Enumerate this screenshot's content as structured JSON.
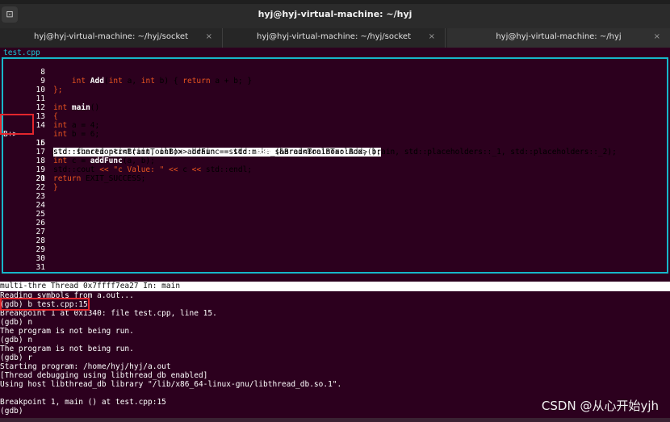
{
  "window": {
    "title": "hyj@hyj-virtual-machine: ~/hyj",
    "new_tab_icon": "terminal-plus-icon"
  },
  "tabs": [
    {
      "label": "hyj@hyj-virtual-machine: ~/hyj/socket",
      "close": "×"
    },
    {
      "label": "hyj@hyj-virtual-machine: ~/hyj/socket",
      "close": "×"
    },
    {
      "label": "hyj@hyj-virtual-machine: ~/hyj",
      "close": "×"
    }
  ],
  "source": {
    "filename": "test.cpp",
    "breakpoint_marker": "B+>",
    "lines": [
      {
        "num": "8"
      },
      {
        "num": "9"
      },
      {
        "num": "10"
      },
      {
        "num": "11"
      },
      {
        "num": "12"
      },
      {
        "num": "13"
      },
      {
        "num": "14"
      },
      {
        "num": "15"
      },
      {
        "num": "16"
      },
      {
        "num": "17"
      },
      {
        "num": "18"
      },
      {
        "num": "19"
      },
      {
        "num": "20"
      },
      {
        "num": "21"
      },
      {
        "num": "22"
      },
      {
        "num": "23"
      },
      {
        "num": "24"
      },
      {
        "num": "25"
      },
      {
        "num": "26"
      },
      {
        "num": "27"
      },
      {
        "num": "28"
      },
      {
        "num": "29"
      },
      {
        "num": "30"
      },
      {
        "num": "31"
      }
    ]
  },
  "status_bar": "multi-thre Thread 0x7ffff7ea27 In: main",
  "console": {
    "lines": [
      "Reading symbols from a.out...",
      "(gdb) b test.cpp:15",
      "Breakpoint 1 at 0x1340: file test.cpp, line 15.",
      "(gdb) n",
      "The program is not being run.",
      "(gdb) n",
      "The program is not being run.",
      "(gdb) r",
      "Starting program: /home/hyj/hyj/a.out",
      "[Thread debugging using libthread_db enabled]",
      "Using host libthread_db library \"/lib/x86_64-linux-gnu/libthread_db.so.1\".",
      "",
      "Breakpoint 1, main () at test.cpp:15",
      "(gdb)"
    ]
  },
  "watermark": "CSDN @从心开始yjh",
  "colors": {
    "accent": "#e95420",
    "frame": "#17b6c9",
    "background": "#2c001e",
    "highlight_box": "#e3262d"
  }
}
